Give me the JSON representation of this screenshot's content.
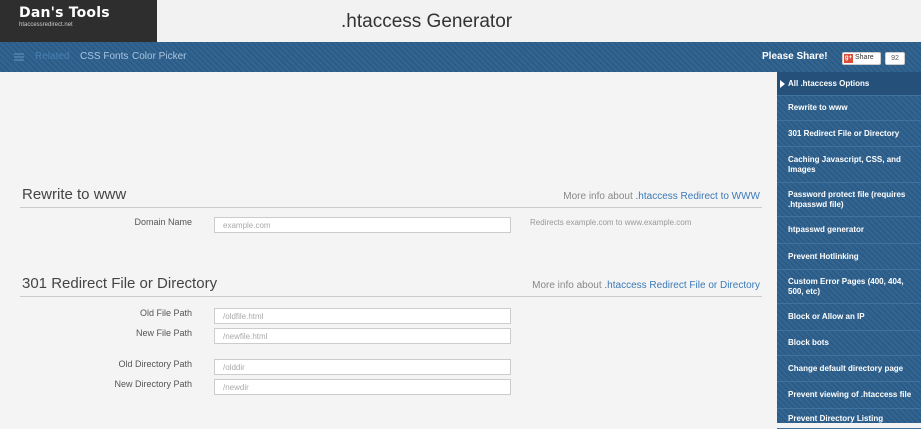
{
  "logo": {
    "title": "Dan's Tools",
    "subtitle": "htaccessredirect.net"
  },
  "app_title": ".htaccess Generator",
  "nav": {
    "menu_icon": "menu-icon",
    "related": "Related",
    "css_fonts": "CSS Fonts",
    "color_picker": "Color Picker"
  },
  "share": {
    "label": "Please Share!",
    "gplus_badge": "g+",
    "gplus_label": "Share",
    "count": "92"
  },
  "sidebar": {
    "items": [
      {
        "label": "All .htaccess Options",
        "active": true
      },
      {
        "label": "Rewrite to www"
      },
      {
        "label": "301 Redirect File or Directory"
      },
      {
        "label": "Caching Javascript, CSS, and Images"
      },
      {
        "label": "Password protect file (requires .htpasswd file)"
      },
      {
        "label": "htpasswd generator"
      },
      {
        "label": "Prevent Hotlinking"
      },
      {
        "label": "Custom Error Pages (400, 404, 500, etc)"
      },
      {
        "label": "Block or Allow an IP"
      },
      {
        "label": "Block bots"
      },
      {
        "label": "Change default directory page"
      },
      {
        "label": "Prevent viewing of .htaccess file"
      },
      {
        "label": "Prevent Directory Listing"
      }
    ]
  },
  "rewrite": {
    "title": "Rewrite to www",
    "more_prefix": "More info about ",
    "more_link": ".htaccess Redirect to WWW",
    "domain_label": "Domain Name",
    "domain_placeholder": "example.com",
    "hint": "Redirects example.com to www.example.com"
  },
  "redirect301": {
    "title": "301 Redirect File or Directory",
    "more_prefix": "More info about ",
    "more_link": ".htaccess Redirect File or Directory",
    "old_file_label": "Old File Path",
    "old_file_placeholder": "/oldfile.html",
    "new_file_label": "New File Path",
    "new_file_placeholder": "/newfile.html",
    "old_dir_label": "Old Directory Path",
    "old_dir_placeholder": "/olddir",
    "new_dir_label": "New Directory Path",
    "new_dir_placeholder": "/newdir"
  }
}
